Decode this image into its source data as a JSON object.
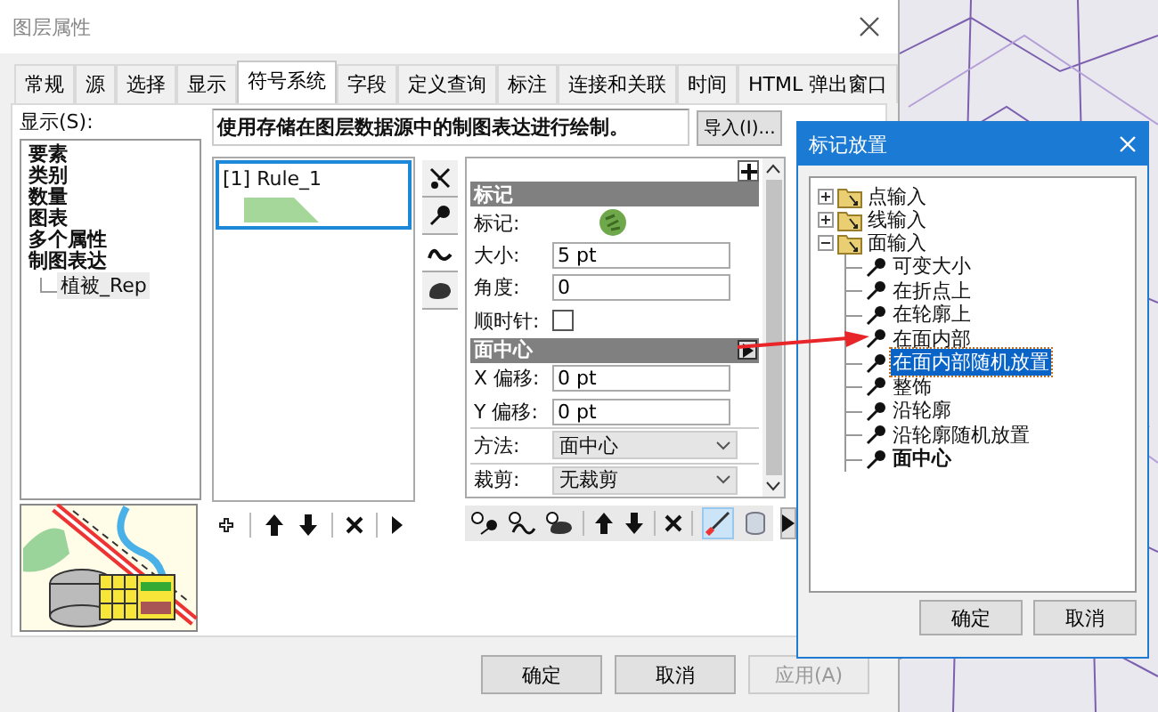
{
  "window": {
    "title": "图层属性"
  },
  "tabs": [
    {
      "label": "常规",
      "selected": false
    },
    {
      "label": "源",
      "selected": false
    },
    {
      "label": "选择",
      "selected": false
    },
    {
      "label": "显示",
      "selected": false
    },
    {
      "label": "符号系统",
      "selected": true
    },
    {
      "label": "字段",
      "selected": false
    },
    {
      "label": "定义查询",
      "selected": false
    },
    {
      "label": "标注",
      "selected": false
    },
    {
      "label": "连接和关联",
      "selected": false
    },
    {
      "label": "时间",
      "selected": false
    },
    {
      "label": "HTML 弹出窗口",
      "selected": false
    }
  ],
  "show_label": "显示(S):",
  "show_list": [
    {
      "label": "要素",
      "selected": false
    },
    {
      "label": "类别",
      "selected": false
    },
    {
      "label": "数量",
      "selected": false
    },
    {
      "label": "图表",
      "selected": false
    },
    {
      "label": "多个属性",
      "selected": false
    },
    {
      "label": "制图表达",
      "selected": false,
      "children": [
        {
          "label": "植被_Rep",
          "selected": true
        }
      ]
    }
  ],
  "description": "使用存储在图层数据源中的制图表达进行绘制。",
  "import_button": "导入(I)...",
  "rules": [
    {
      "label": "[1] Rule_1",
      "selected": true
    }
  ],
  "property_panel": {
    "sections": [
      {
        "title": "标记",
        "rows": [
          {
            "kind": "symbol",
            "label": "标记:"
          },
          {
            "kind": "text",
            "label": "大小:",
            "value": "5 pt"
          },
          {
            "kind": "text",
            "label": "角度:",
            "value": "0"
          },
          {
            "kind": "checkbox",
            "label": "顺时针:",
            "checked": false
          }
        ]
      },
      {
        "title": "面中心",
        "rows": [
          {
            "kind": "text",
            "label": "X 偏移:",
            "value": "0 pt"
          },
          {
            "kind": "text",
            "label": "Y 偏移:",
            "value": "0 pt"
          },
          {
            "kind": "select",
            "label": "方法:",
            "value": "面中心"
          },
          {
            "kind": "select",
            "label": "裁剪:",
            "value": "无裁剪"
          }
        ]
      }
    ]
  },
  "buttons": [
    {
      "label": "确定",
      "disabled": false
    },
    {
      "label": "取消",
      "disabled": false
    },
    {
      "label": "应用(A)",
      "disabled": true
    }
  ],
  "placement_dialog": {
    "title": "标记放置",
    "tree": [
      {
        "label": "点输入",
        "expanded": false
      },
      {
        "label": "线输入",
        "expanded": false
      },
      {
        "label": "面输入",
        "expanded": true,
        "children": [
          {
            "label": "可变大小",
            "selected": false,
            "current": false
          },
          {
            "label": "在折点上",
            "selected": false,
            "current": false
          },
          {
            "label": "在轮廓上",
            "selected": false,
            "current": false
          },
          {
            "label": "在面内部",
            "selected": false,
            "current": false
          },
          {
            "label": "在面内部随机放置",
            "selected": true,
            "current": false
          },
          {
            "label": "整饰",
            "selected": false,
            "current": false
          },
          {
            "label": "沿轮廓",
            "selected": false,
            "current": false
          },
          {
            "label": "沿轮廓随机放置",
            "selected": false,
            "current": false
          },
          {
            "label": "面中心",
            "selected": false,
            "current": true
          }
        ]
      }
    ],
    "buttons": [
      "确定",
      "取消"
    ]
  }
}
